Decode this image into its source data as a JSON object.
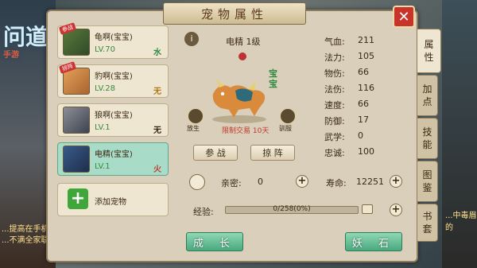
{
  "background": {
    "logo_text": "问道",
    "logo_sub": "手游",
    "bottom_left_text": "...提高在手机\n...不满全家联",
    "bottom_right_text": "...中毒眉的"
  },
  "window": {
    "title": "宠物属性",
    "close_symbol": "✕"
  },
  "pets": [
    {
      "name": "龟啊(宝宝)",
      "level": "LV.70",
      "element": "水",
      "element_color": "#2e8a40",
      "badge": "参战",
      "selected": false
    },
    {
      "name": "豹啊(宝宝)",
      "level": "LV.28",
      "element": "无",
      "element_color": "#b07a1a",
      "badge": "掠阵",
      "selected": false
    },
    {
      "name": "狼啊(宝宝)",
      "level": "LV.1",
      "element": "无",
      "element_color": "#3a2a14",
      "badge": "",
      "selected": false
    },
    {
      "name": "电精(宝宝)",
      "level": "LV.1",
      "element": "火",
      "element_color": "#c0392b",
      "badge": "",
      "selected": true
    }
  ],
  "add_pet_label": "添加宠物",
  "detail": {
    "title": "电精 1级",
    "baobao_tag": "宝宝",
    "left_icon_label": "放生",
    "right_icon_label": "驯服",
    "trade_note": "限制交易 10天",
    "fight_button": "参 战",
    "assist_button": "掠 阵"
  },
  "stats": [
    {
      "label": "气血:",
      "value": "211"
    },
    {
      "label": "法力:",
      "value": "105"
    },
    {
      "label": "物伤:",
      "value": "66"
    },
    {
      "label": "法伤:",
      "value": "116"
    },
    {
      "label": "速度:",
      "value": "66"
    },
    {
      "label": "防御:",
      "value": "17"
    },
    {
      "label": "武学:",
      "value": "0"
    },
    {
      "label": "忠诚:",
      "value": "100"
    }
  ],
  "intimacy": {
    "label": "亲密:",
    "value": "0"
  },
  "lifespan": {
    "label": "寿命:",
    "value": "12251"
  },
  "experience": {
    "label": "经验:",
    "value": "0/258(0%)",
    "progress": 0
  },
  "bottom_buttons": {
    "grow": "成 长",
    "demon_stone": "妖 石"
  },
  "tabs": [
    {
      "label": "属\n性",
      "active": true
    },
    {
      "label": "加\n点",
      "active": false
    },
    {
      "label": "技\n能",
      "active": false
    },
    {
      "label": "图\n鉴",
      "active": false
    },
    {
      "label": "书\n套",
      "active": false
    }
  ]
}
